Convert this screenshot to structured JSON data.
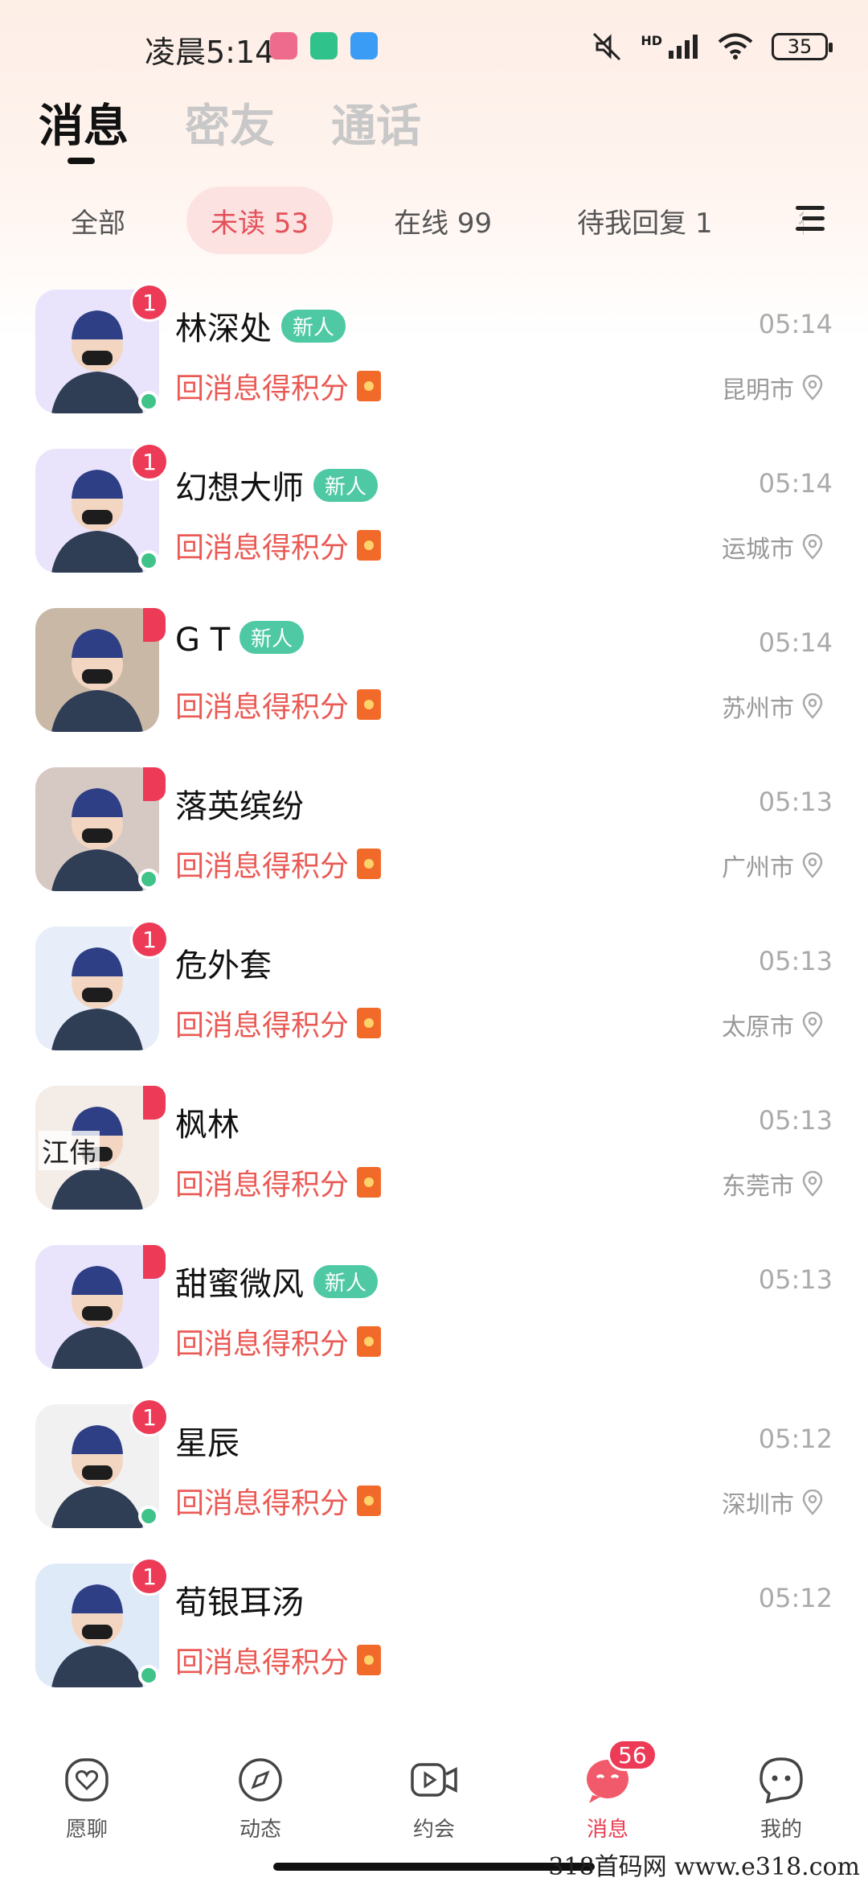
{
  "status_bar": {
    "time": "凌晨5:14",
    "battery": "35",
    "network": "HD"
  },
  "top_tabs": [
    {
      "label": "消息",
      "active": true
    },
    {
      "label": "密友",
      "active": false
    },
    {
      "label": "通话",
      "active": false
    }
  ],
  "filters": [
    {
      "label": "全部"
    },
    {
      "label": "未读 53",
      "active": true
    },
    {
      "label": "在线 99"
    },
    {
      "label": "待我回复 1"
    },
    {
      "label": "待"
    }
  ],
  "conversations": [
    {
      "name": "林深处",
      "is_new": true,
      "new_label": "新人",
      "badge": "1",
      "online": true,
      "time": "05:14",
      "reward": "回消息得积分",
      "city": "昆明市",
      "avatar_color": "#e9e4fb"
    },
    {
      "name": "幻想大师",
      "is_new": true,
      "new_label": "新人",
      "badge": "1",
      "online": true,
      "time": "05:14",
      "reward": "回消息得积分",
      "city": "运城市",
      "avatar_color": "#e9e4fb"
    },
    {
      "name": "G T",
      "is_new": true,
      "new_label": "新人",
      "badge": "",
      "online": false,
      "time": "05:14",
      "reward": "回消息得积分",
      "city": "苏州市",
      "avatar_color": "#c9b8a6"
    },
    {
      "name": "落英缤纷",
      "is_new": false,
      "new_label": "",
      "badge": "",
      "online": true,
      "time": "05:13",
      "reward": "回消息得积分",
      "city": "广州市",
      "avatar_color": "#d6c9c3"
    },
    {
      "name": "危外套",
      "is_new": false,
      "new_label": "",
      "badge": "1",
      "online": false,
      "time": "05:13",
      "reward": "回消息得积分",
      "city": "太原市",
      "avatar_color": "#e8eef9"
    },
    {
      "name": "枫林",
      "is_new": false,
      "new_label": "",
      "badge": "",
      "online": false,
      "time": "05:13",
      "reward": "回消息得积分",
      "city": "东莞市",
      "avatar_color": "#f4ece7",
      "avatar_text": "江伟"
    },
    {
      "name": "甜蜜微风",
      "is_new": true,
      "new_label": "新人",
      "badge": "",
      "online": false,
      "time": "05:13",
      "reward": "回消息得积分",
      "city": "",
      "avatar_color": "#e9e4fb"
    },
    {
      "name": "星辰",
      "is_new": false,
      "new_label": "",
      "badge": "1",
      "online": true,
      "time": "05:12",
      "reward": "回消息得积分",
      "city": "深圳市",
      "avatar_color": "#f1f1f1"
    },
    {
      "name": "荀银耳汤",
      "is_new": false,
      "new_label": "",
      "badge": "1",
      "online": true,
      "time": "05:12",
      "reward": "回消息得积分",
      "city": "",
      "avatar_color": "#dfeaf9"
    }
  ],
  "bottom_nav": [
    {
      "label": "愿聊",
      "icon": "heart-chat-icon"
    },
    {
      "label": "动态",
      "icon": "compass-icon"
    },
    {
      "label": "约会",
      "icon": "video-icon"
    },
    {
      "label": "消息",
      "icon": "message-icon",
      "active": true,
      "badge": "56"
    },
    {
      "label": "我的",
      "icon": "profile-face-icon"
    }
  ],
  "watermark": "318首码网 www.e318.com"
}
